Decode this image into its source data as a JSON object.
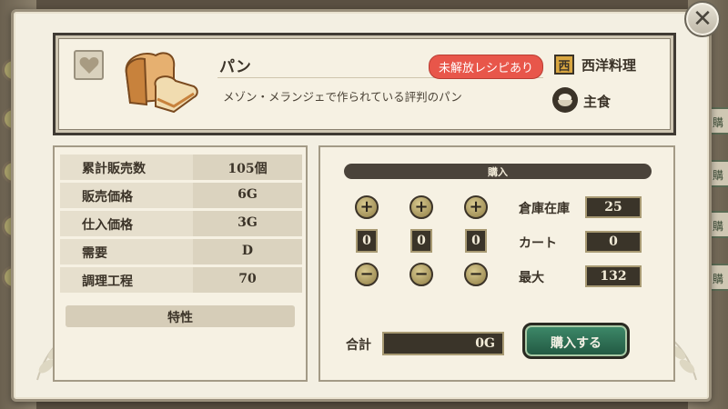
{
  "close_label": "✕",
  "item": {
    "name": "パン",
    "badge": "未解放レシピあり",
    "description": "メゾン・メランジェで作られている評判のパン",
    "category_icon": "西",
    "category": "西洋料理",
    "type": "主食",
    "favorite_icon": "heart-icon"
  },
  "stats": [
    {
      "label": "累計販売数",
      "value": "105個"
    },
    {
      "label": "販売価格",
      "value": "6G"
    },
    {
      "label": "仕入価格",
      "value": "3G"
    },
    {
      "label": "需要",
      "value": "D"
    },
    {
      "label": "調理工程",
      "value": "70"
    }
  ],
  "traits_header": "特性",
  "purchase": {
    "title": "購入",
    "plus": "+",
    "minus": "−",
    "quantities": [
      "0",
      "0",
      "0"
    ],
    "inventory": [
      {
        "label": "倉庫在庫",
        "value": "25"
      },
      {
        "label": "カート",
        "value": "0"
      },
      {
        "label": "最大",
        "value": "132"
      }
    ],
    "total_label": "合計",
    "total_value": "0G",
    "buy_label": "購入する"
  },
  "background_tabs": [
    "購",
    "購",
    "購",
    "購"
  ],
  "colors": {
    "badge": "#e8564a",
    "buy_button": "#2f7456",
    "panel": "#f6f1e3",
    "dark_box": "#3a3429",
    "category_icon": "#d9a640"
  }
}
